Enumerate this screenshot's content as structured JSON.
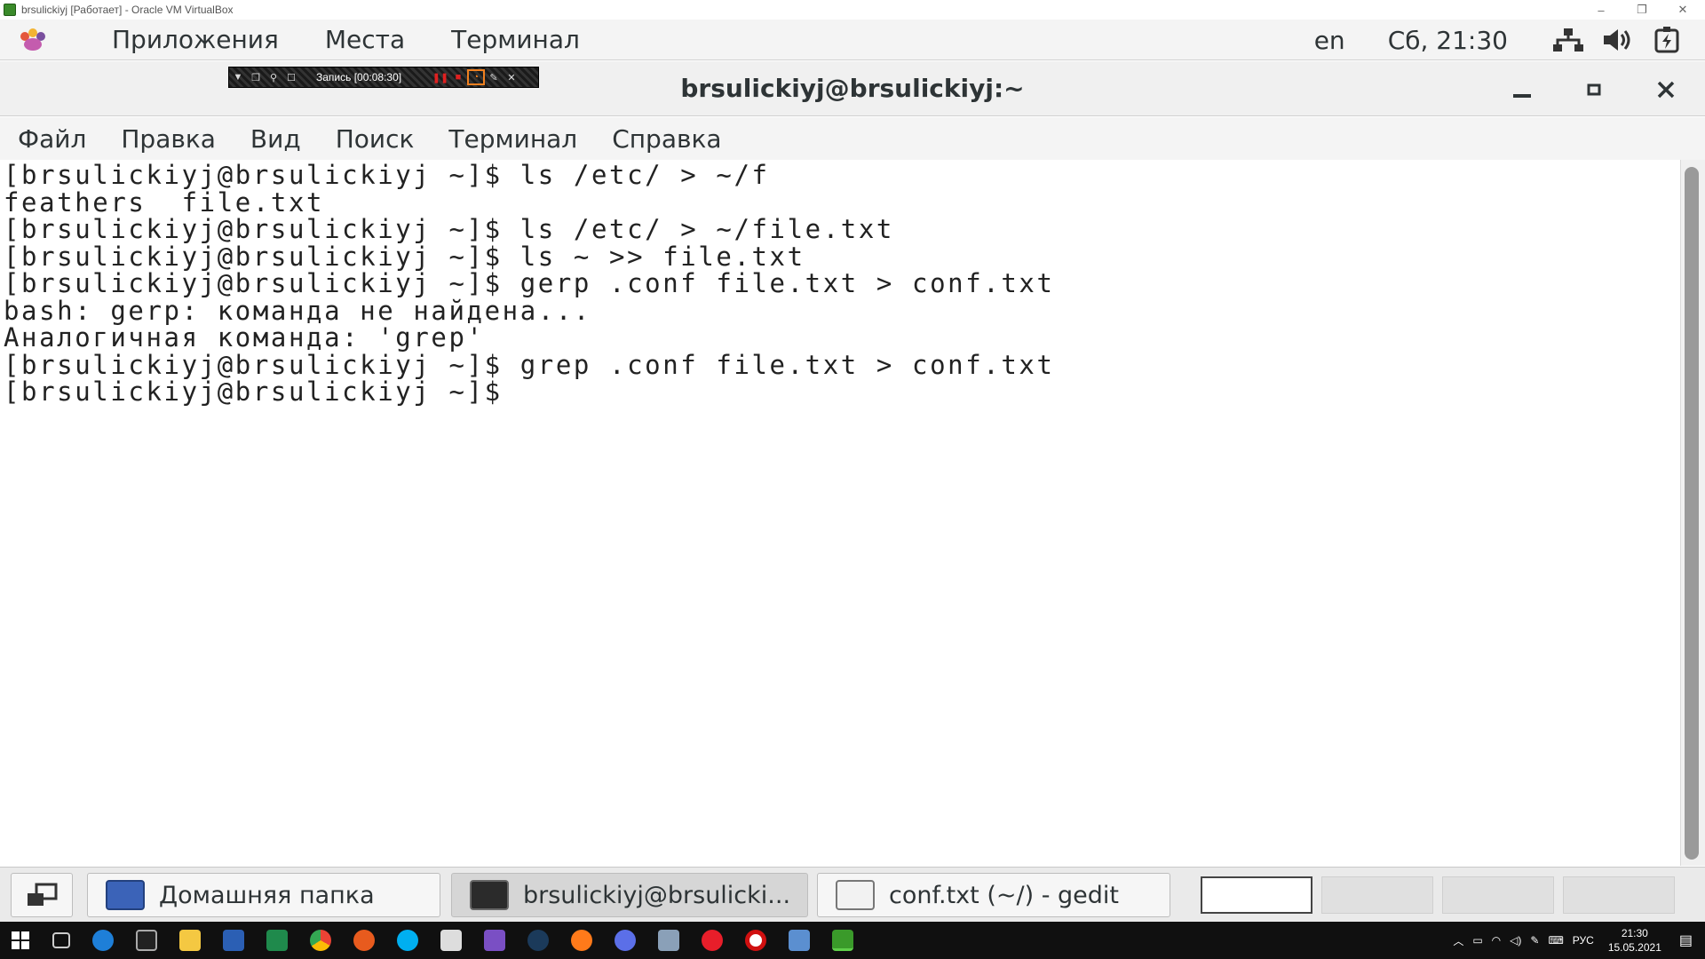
{
  "vbox": {
    "title": "brsulickiyj [Работает] - Oracle VM VirtualBox",
    "controls": [
      "–",
      "❐",
      "✕"
    ]
  },
  "gnome_top": {
    "menus": [
      "Приложения",
      "Места",
      "Терминал"
    ],
    "lang": "en",
    "datetime": "Сб, 21:30"
  },
  "recorder": {
    "label": "Запись [00:08:30]"
  },
  "terminal": {
    "title": "brsulickiyj@brsulickiyj:~",
    "menu": [
      "Файл",
      "Правка",
      "Вид",
      "Поиск",
      "Терминал",
      "Справка"
    ],
    "lines": [
      "[brsulickiyj@brsulickiyj ~]$ ls /etc/ > ~/f",
      "feathers  file.txt",
      "[brsulickiyj@brsulickiyj ~]$ ls /etc/ > ~/file.txt",
      "[brsulickiyj@brsulickiyj ~]$ ls ~ >> file.txt",
      "[brsulickiyj@brsulickiyj ~]$ gerp .conf file.txt > conf.txt",
      "bash: gerp: команда не найдена...",
      "Аналогичная команда: 'grep'",
      "[brsulickiyj@brsulickiyj ~]$ grep .conf file.txt > conf.txt",
      "[brsulickiyj@brsulickiyj ~]$ "
    ]
  },
  "window_list": {
    "items": [
      {
        "label": "Домашняя папка",
        "icon": "file-cabinet-icon",
        "active": false
      },
      {
        "label": "brsulickiyj@brsulicki...",
        "icon": "terminal-icon",
        "active": true
      },
      {
        "label": "conf.txt (~/) - gedit",
        "icon": "text-editor-icon",
        "active": false
      }
    ]
  },
  "win_taskbar": {
    "lang": "РУС",
    "time": "21:30",
    "date": "15.05.2021"
  },
  "colors": {
    "terminal_bg": "#ffffff",
    "terminal_fg": "#222222",
    "taskbar_bg": "#101010"
  }
}
